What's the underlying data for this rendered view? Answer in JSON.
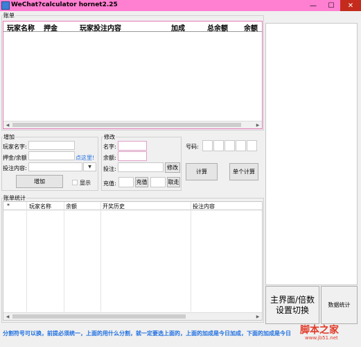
{
  "window": {
    "title": "WeChat?calculator hornet2.25",
    "min_glyph": "—",
    "max_glyph": "☐",
    "close_glyph": "✕"
  },
  "ledger": {
    "label": "账单",
    "columns": [
      "玩家名称",
      "押金",
      "玩家投注内容",
      "加成",
      "总余额",
      "余额"
    ]
  },
  "add_panel": {
    "label": "增加",
    "name_label": "玩家名字:",
    "deposit_label": "押金/余额",
    "bet_label": "投注内容:",
    "hint_link": "点这里!",
    "add_button": "增加",
    "show_checkbox": "显示"
  },
  "edit_panel": {
    "label": "修改",
    "name_label": "名字:",
    "balance_label": "余额:",
    "bet_label": "投注:",
    "edit_button": "修改",
    "recharge_label": "充值:",
    "recharge_button": "充值",
    "withdraw_button": "取走"
  },
  "number_panel": {
    "label": "号码:",
    "calc_button": "计算",
    "single_calc_button": "单个计算"
  },
  "stats": {
    "label": "账单统计",
    "columns": [
      "*",
      "玩家名称",
      "余额",
      "开奖历史",
      "投注内容"
    ]
  },
  "right": {
    "main_switch_button_line1": "主界面/倍数",
    "main_switch_button_line2": "设置切换",
    "data_stats_button": "数据统计"
  },
  "footer": {
    "text": "分割符号可以换，前提必须统一，上面的用什么分割，就一定要选上面的，上面的加成是今日加成，下面的加成是今日"
  },
  "watermark": {
    "main": "脚本之家",
    "sub": "www.jb51.net"
  },
  "colors": {
    "titlebar": "#ff7fd1",
    "accent_border": "#e47ab8",
    "footer_text": "#1e6fe0",
    "watermark": "#e13b2a"
  }
}
